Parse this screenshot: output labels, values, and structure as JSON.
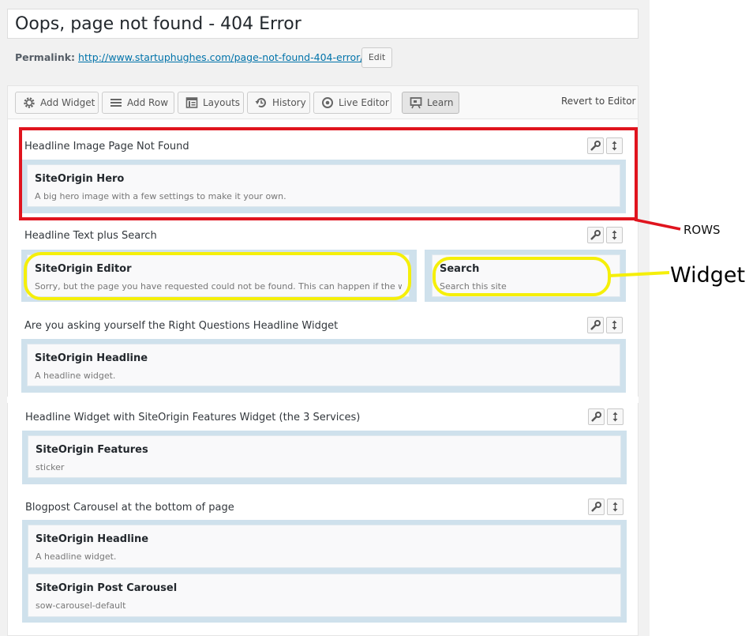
{
  "page": {
    "title": "Oops, page not found - 404 Error",
    "permalink_label": "Permalink:",
    "permalink_base": "http://www.startuphughes.com/",
    "permalink_slug": "page-not-found-404-error/",
    "edit_label": "Edit"
  },
  "toolbar": {
    "buttons": [
      {
        "label": "Add Widget",
        "icon": "gear-icon"
      },
      {
        "label": "Add Row",
        "icon": "menu-lines-icon"
      },
      {
        "label": "Layouts",
        "icon": "layout-icon"
      },
      {
        "label": "History",
        "icon": "history-icon"
      },
      {
        "label": "Live Editor",
        "icon": "eye-icon"
      },
      {
        "label": "Learn",
        "icon": "presentation-icon"
      }
    ],
    "revert_label": "Revert to Editor"
  },
  "rows": [
    {
      "title": "Headline Image Page Not Found",
      "widgets": [
        {
          "title": "SiteOrigin Hero",
          "desc": "A big hero image with a few settings to make it your own."
        }
      ]
    },
    {
      "title": "Headline Text plus Search",
      "widgets": [
        {
          "title": "SiteOrigin Editor",
          "desc": "Sorry, but the page you have requested could not be found. This can happen if the web"
        },
        {
          "title": "Search",
          "desc": "Search this site"
        }
      ]
    },
    {
      "title": "Are you asking yourself the Right Questions Headline Widget",
      "widgets": [
        {
          "title": "SiteOrigin Headline",
          "desc": "A headline widget."
        }
      ]
    },
    {
      "title": "Headline Widget with SiteOrigin Features Widget (the 3 Services)",
      "widgets": [
        {
          "title": "SiteOrigin Features",
          "desc": "sticker"
        }
      ]
    },
    {
      "title": "Blogpost Carousel at the bottom of page",
      "widgets": [
        {
          "title": "SiteOrigin Headline",
          "desc": "A headline widget."
        },
        {
          "title": "SiteOrigin Post Carousel",
          "desc": "sow-carousel-default"
        }
      ]
    }
  ],
  "annotations": {
    "rows_label": "ROWS",
    "widget_label": "Widget",
    "rows_color": "#e0141e",
    "widget_color": "#f5ef0a"
  },
  "colors": {
    "link": "#0073aa",
    "cell_bg": "#cfe1ec"
  }
}
